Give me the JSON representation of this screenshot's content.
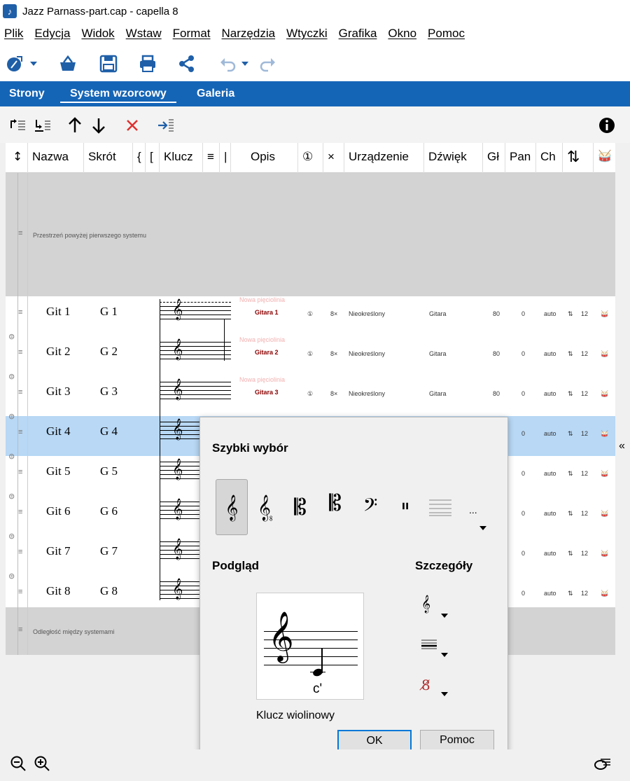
{
  "window": {
    "title": "Jazz Parnass-part.cap  - capella 8"
  },
  "menu": [
    "Plik",
    "Edycja",
    "Widok",
    "Wstaw",
    "Format",
    "Narzędzia",
    "Wtyczki",
    "Grafika",
    "Okno",
    "Pomoc"
  ],
  "tabs": [
    {
      "label": "Strony",
      "active": false
    },
    {
      "label": "System wzorcowy",
      "active": true
    },
    {
      "label": "Galeria",
      "active": false
    }
  ],
  "columns": [
    "Nazwa",
    "Skrót",
    "{",
    "[",
    "Klucz",
    "≡",
    "|",
    "Opis",
    "①",
    "×",
    "Urządzenie",
    "Dźwięk",
    "Gł",
    "Pan",
    "Ch",
    "⇅",
    "🥁"
  ],
  "grid": {
    "top_space_label": "Przestrzeń powyżej pierwszego systemu",
    "bottom_space_label": "Odległość między systemami",
    "new_staff_label": "Nowa pięciolinia",
    "rows": [
      {
        "name": "Git 1",
        "abbr": "G 1",
        "desc": "Gitara 1",
        "transp": "8×",
        "device": "Nieokreślony",
        "sound": "Gitara",
        "vol": "80",
        "pan": "0",
        "ch": "auto",
        "num": "12"
      },
      {
        "name": "Git 2",
        "abbr": "G 2",
        "desc": "Gitara 2",
        "transp": "8×",
        "device": "Nieokreślony",
        "sound": "Gitara",
        "vol": "80",
        "pan": "0",
        "ch": "auto",
        "num": "12"
      },
      {
        "name": "Git 3",
        "abbr": "G 3",
        "desc": "Gitara 3",
        "transp": "8×",
        "device": "Nieokreślony",
        "sound": "Gitara",
        "vol": "80",
        "pan": "0",
        "ch": "auto",
        "num": "12"
      },
      {
        "name": "Git 4",
        "abbr": "G 4",
        "pan": "0",
        "ch": "auto",
        "num": "12",
        "selected": true
      },
      {
        "name": "Git 5",
        "abbr": "G 5",
        "pan": "0",
        "ch": "auto",
        "num": "12"
      },
      {
        "name": "Git 6",
        "abbr": "G 6",
        "pan": "0",
        "ch": "auto",
        "num": "12"
      },
      {
        "name": "Git 7",
        "abbr": "G 7",
        "pan": "0",
        "ch": "auto",
        "num": "12"
      },
      {
        "name": "Git 8",
        "abbr": "G 8",
        "pan": "0",
        "ch": "auto",
        "num": "12"
      }
    ]
  },
  "dialog": {
    "quick_title": "Szybki wybór",
    "preview_title": "Podgląd",
    "details_title": "Szczegóły",
    "more_label": "...",
    "preview_note": "c'",
    "clef_name": "Klucz wiolinowy",
    "ok_label": "OK",
    "help_label": "Pomoc"
  },
  "side_collapse": "«"
}
